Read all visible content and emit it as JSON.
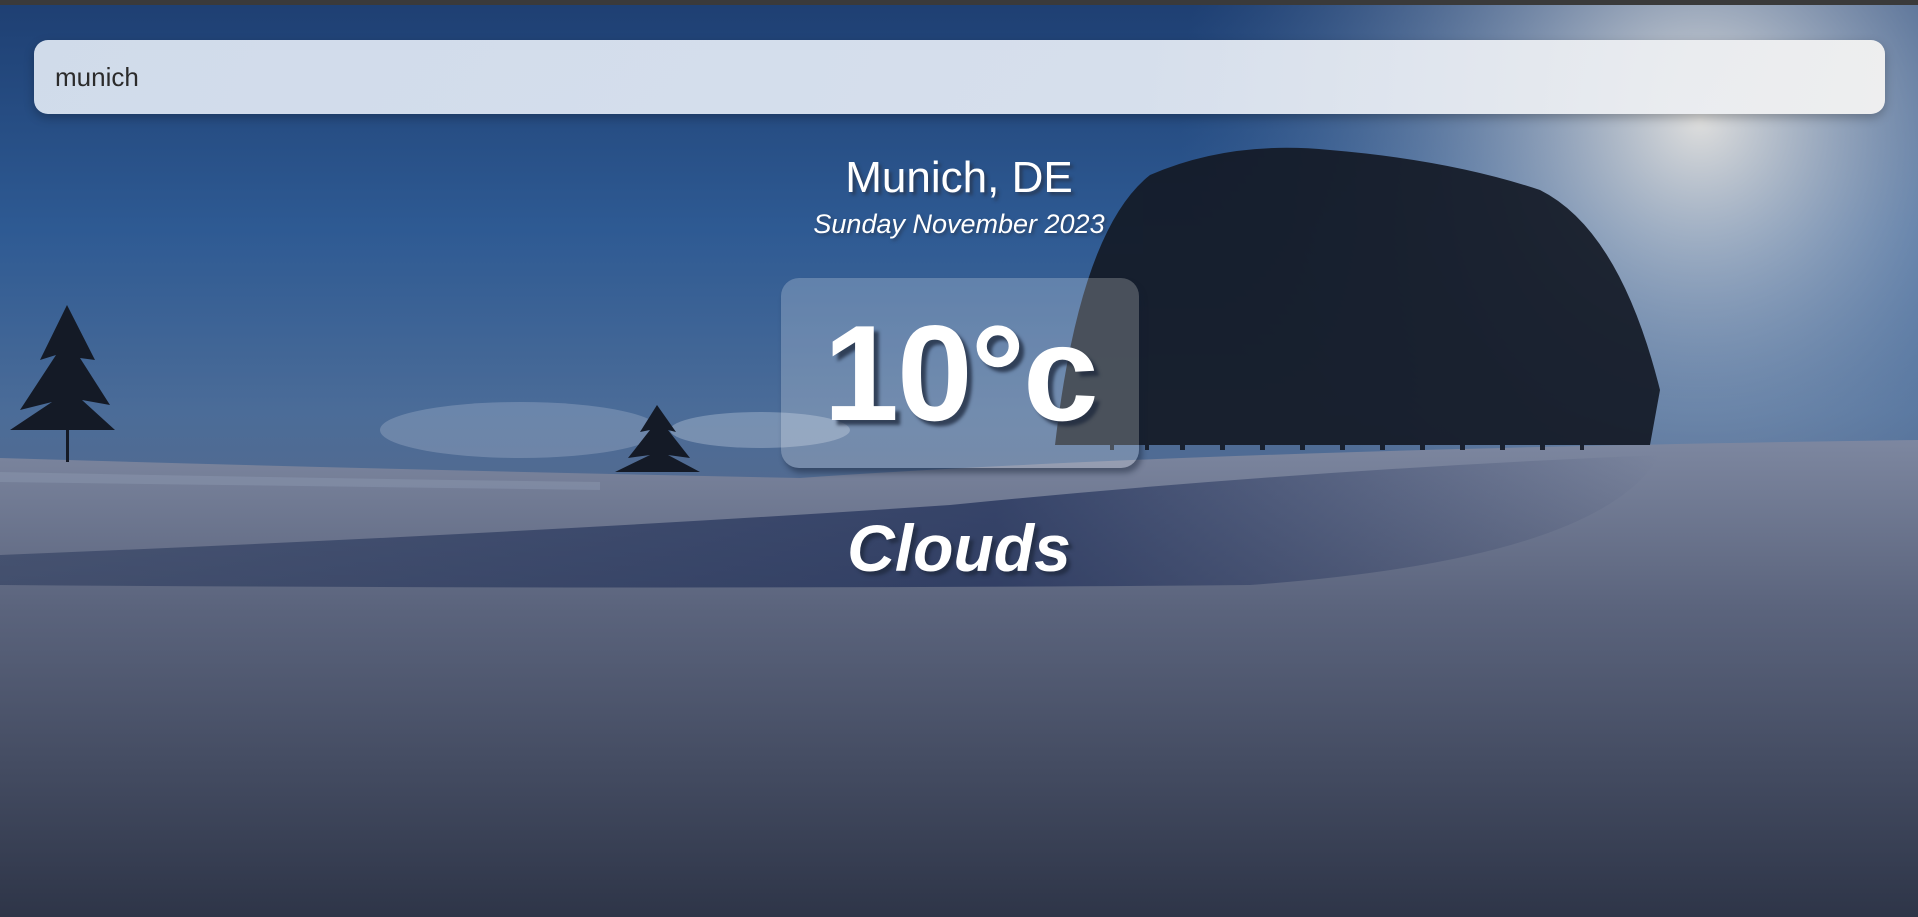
{
  "search": {
    "value": "munich",
    "placeholder": ""
  },
  "location": {
    "city": "Munich, DE",
    "date": "Sunday November 2023"
  },
  "weather": {
    "temperature": "10°c",
    "condition": "Clouds"
  },
  "background": {
    "sky_top_color": "#1e3f72",
    "snow_color": "#3d4a63"
  }
}
